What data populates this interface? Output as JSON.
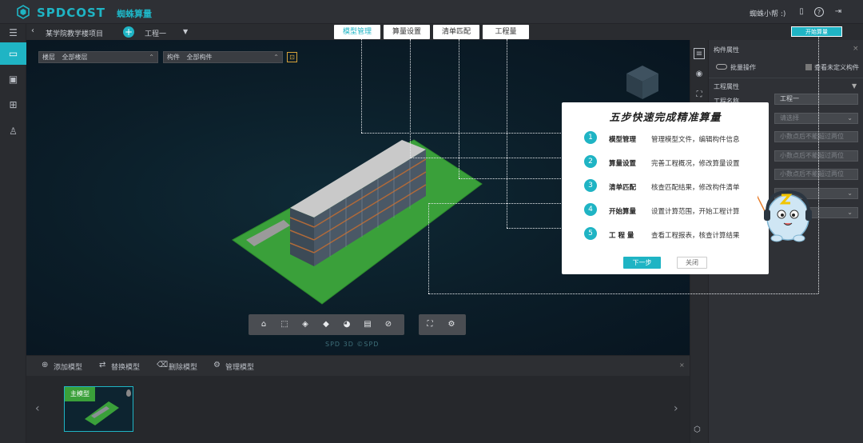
{
  "app": {
    "brand": "SPDCOST",
    "product": "蜘蛛算量",
    "user": "蜘蛛小帮 :)"
  },
  "colors": {
    "accent": "#1fb4c4",
    "background": "#2b2d31",
    "viewport": "#0b1d28",
    "grass": "#3aa03a"
  },
  "header": {
    "back_icon": "chevron-left-icon",
    "project_name": "某学院教学楼项目",
    "project_select": "工程一",
    "tabs": [
      {
        "label": "模型管理",
        "active": true
      },
      {
        "label": "算量设置",
        "active": false
      },
      {
        "label": "清单匹配",
        "active": false
      },
      {
        "label": "工程量",
        "active": false
      }
    ],
    "start_button": "开始算量"
  },
  "leftnav": {
    "items": [
      "list-icon",
      "folder-icon",
      "chart-icon",
      "grid-icon",
      "user-icon"
    ]
  },
  "viewport": {
    "floor_filter": {
      "label": "楼层",
      "value": "全部楼层"
    },
    "component_filter": {
      "label": "构件",
      "value": "全部构件"
    },
    "watermark": "SPD 3D ©SPD"
  },
  "toolbar": {
    "tools": [
      "home-icon",
      "select-icon",
      "box-icon",
      "cube-icon",
      "pie-icon",
      "layers-icon",
      "eye-off-icon"
    ],
    "tools2": [
      "fullscreen-icon",
      "gear-icon"
    ]
  },
  "bottom": {
    "actions": [
      {
        "icon": "add-icon",
        "label": "添加模型"
      },
      {
        "icon": "swap-icon",
        "label": "替换模型"
      },
      {
        "icon": "trash-icon",
        "label": "删除模型"
      },
      {
        "icon": "gear-icon",
        "label": "管理模型"
      }
    ],
    "thumbnail_badge": "主模型"
  },
  "rightpanel": {
    "title": "构件属性",
    "batch_label": "批量操作",
    "undefined_label": "查看未定义构件",
    "section": "工程属性",
    "name_label": "工程名称",
    "fields": [
      "工程一",
      "请选择",
      "小数点后不能超过两位",
      "小数点后不能超过两位",
      "小数点后不能超过两位",
      "",
      ""
    ]
  },
  "guide": {
    "title": "五步快速完成精准算量",
    "steps": [
      {
        "num": "1",
        "name": "模型管理",
        "desc": "管理模型文件，编辑构件信息"
      },
      {
        "num": "2",
        "name": "算量设置",
        "desc": "完善工程概况，修改算量设置"
      },
      {
        "num": "3",
        "name": "清单匹配",
        "desc": "核查匹配结果，修改构件清单"
      },
      {
        "num": "4",
        "name": "开始算量",
        "desc": "设置计算范围，开始工程计算"
      },
      {
        "num": "5",
        "name": "工 程 量",
        "desc": "查看工程报表，核查计算结果"
      }
    ],
    "next": "下一步",
    "close": "关闭"
  }
}
